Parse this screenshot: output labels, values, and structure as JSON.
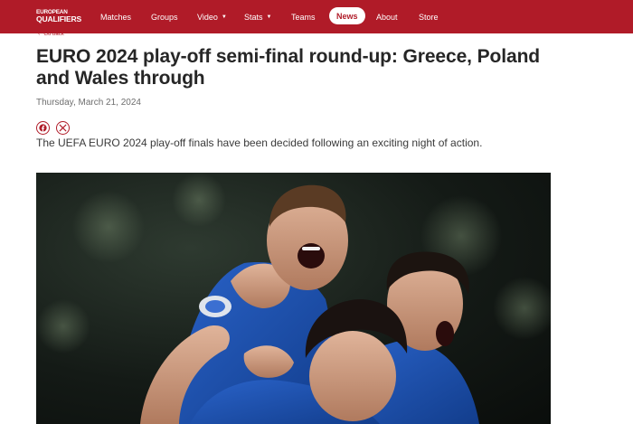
{
  "header": {
    "logo": {
      "line1": "EUROPEAN",
      "line2": "QUALIFIERS"
    },
    "nav": [
      {
        "label": "Matches",
        "dropdown": false
      },
      {
        "label": "Groups",
        "dropdown": false
      },
      {
        "label": "Video",
        "dropdown": true
      },
      {
        "label": "Stats",
        "dropdown": true
      },
      {
        "label": "Teams",
        "dropdown": false
      },
      {
        "label": "News",
        "dropdown": false,
        "active": true
      },
      {
        "label": "About",
        "dropdown": false
      },
      {
        "label": "Store",
        "dropdown": false
      }
    ],
    "caret": "▼"
  },
  "article": {
    "back_label": "Go back",
    "title": "EURO 2024 play-off semi-final round-up: Greece, Poland and Wales through",
    "date": "Thursday, March 21, 2024",
    "lead": "The UEFA EURO 2024 play-off finals have been decided following an exciting night of action.",
    "share": [
      "facebook-icon",
      "x-icon"
    ]
  },
  "colors": {
    "brand_red": "#b01b28",
    "text_dark": "#262626",
    "text_muted": "#6e6e6e"
  }
}
